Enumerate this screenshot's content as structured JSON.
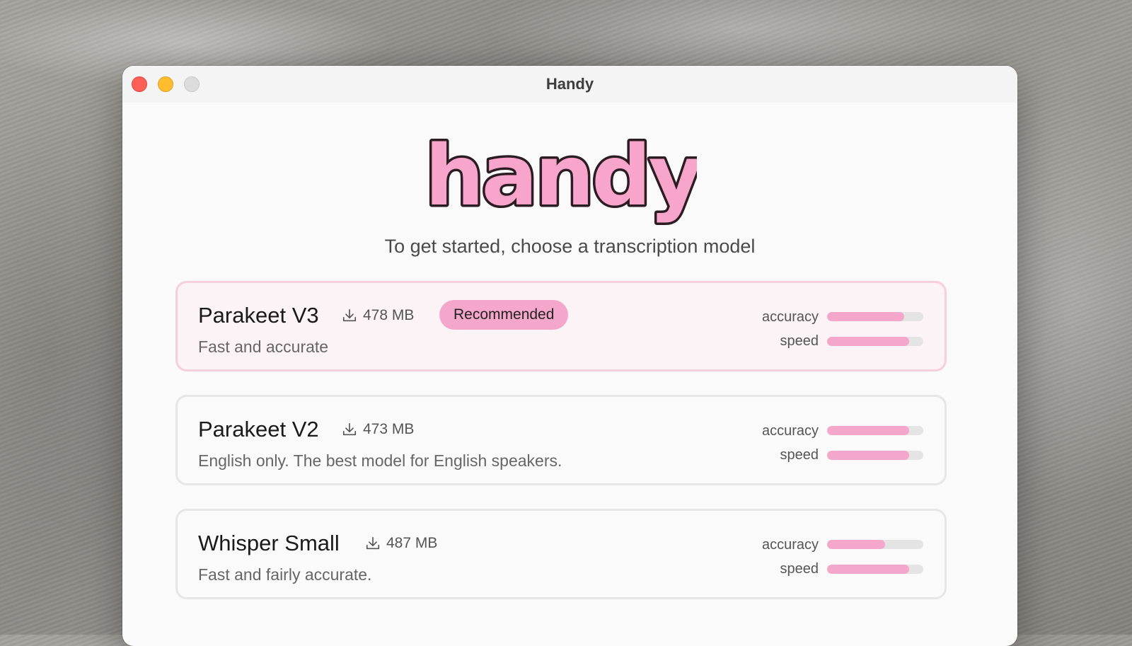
{
  "window": {
    "title": "Handy"
  },
  "logo": {
    "text": "handy"
  },
  "subtitle": "To get started, choose a transcription model",
  "colors": {
    "accent": "#f5a6cb",
    "recommended_border": "#f6cfdc"
  },
  "models": [
    {
      "name": "Parakeet V3",
      "size": "478 MB",
      "badge": "Recommended",
      "description": "Fast and accurate",
      "accuracy_label": "accuracy",
      "speed_label": "speed",
      "accuracy": 0.8,
      "speed": 0.85
    },
    {
      "name": "Parakeet V2",
      "size": "473 MB",
      "badge": "",
      "description": "English only. The best model for English speakers.",
      "accuracy_label": "accuracy",
      "speed_label": "speed",
      "accuracy": 0.85,
      "speed": 0.85
    },
    {
      "name": "Whisper Small",
      "size": "487 MB",
      "badge": "",
      "description": "Fast and fairly accurate.",
      "accuracy_label": "accuracy",
      "speed_label": "speed",
      "accuracy": 0.6,
      "speed": 0.85
    }
  ]
}
